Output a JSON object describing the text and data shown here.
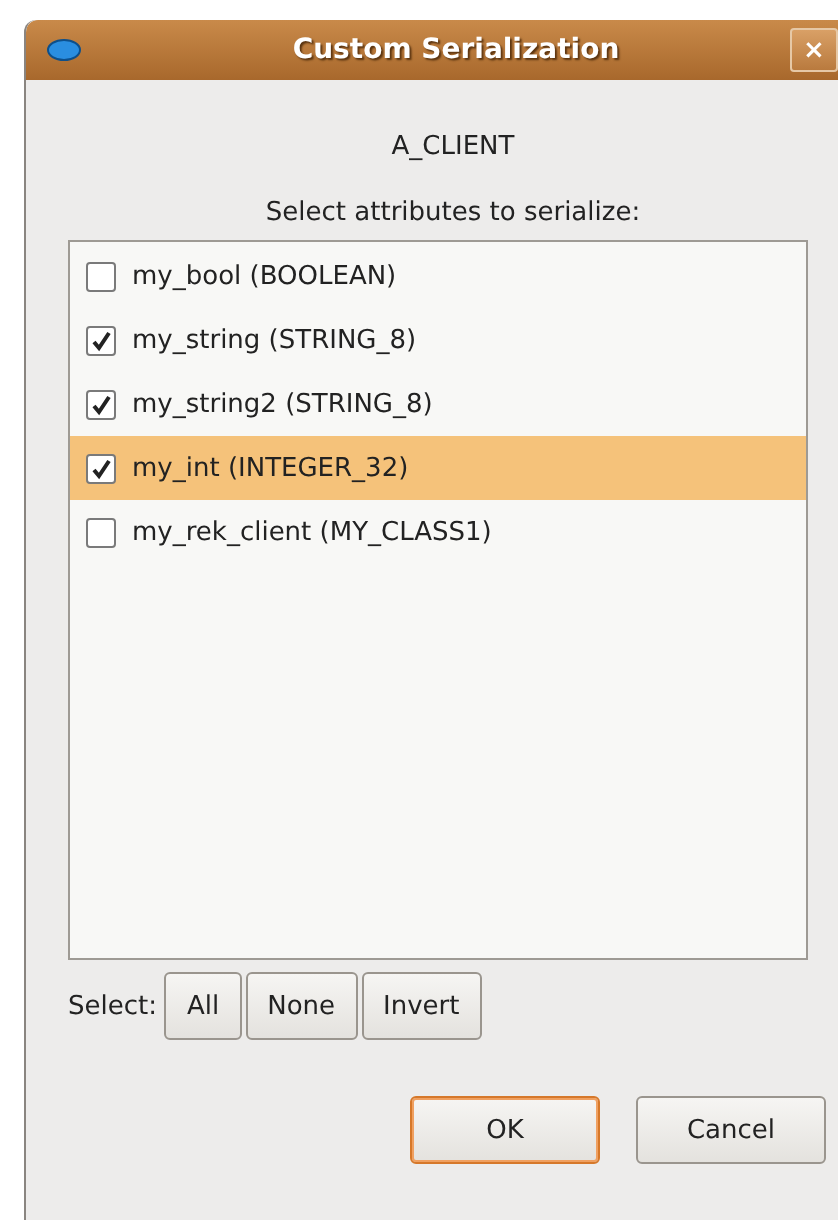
{
  "window": {
    "title": "Custom Serialization",
    "close": "×"
  },
  "class_name": "A_CLIENT",
  "prompt": "Select attributes to serialize:",
  "attributes": [
    {
      "label": "my_bool (BOOLEAN)",
      "checked": false,
      "selected": false
    },
    {
      "label": "my_string (STRING_8)",
      "checked": true,
      "selected": false
    },
    {
      "label": "my_string2 (STRING_8)",
      "checked": true,
      "selected": false
    },
    {
      "label": "my_int (INTEGER_32)",
      "checked": true,
      "selected": true
    },
    {
      "label": "my_rek_client (MY_CLASS1)",
      "checked": false,
      "selected": false
    }
  ],
  "select_label": "Select:",
  "select_buttons": [
    "All",
    "None",
    "Invert"
  ],
  "buttons": [
    {
      "label": "OK",
      "default": true
    },
    {
      "label": "Cancel",
      "default": false
    }
  ]
}
